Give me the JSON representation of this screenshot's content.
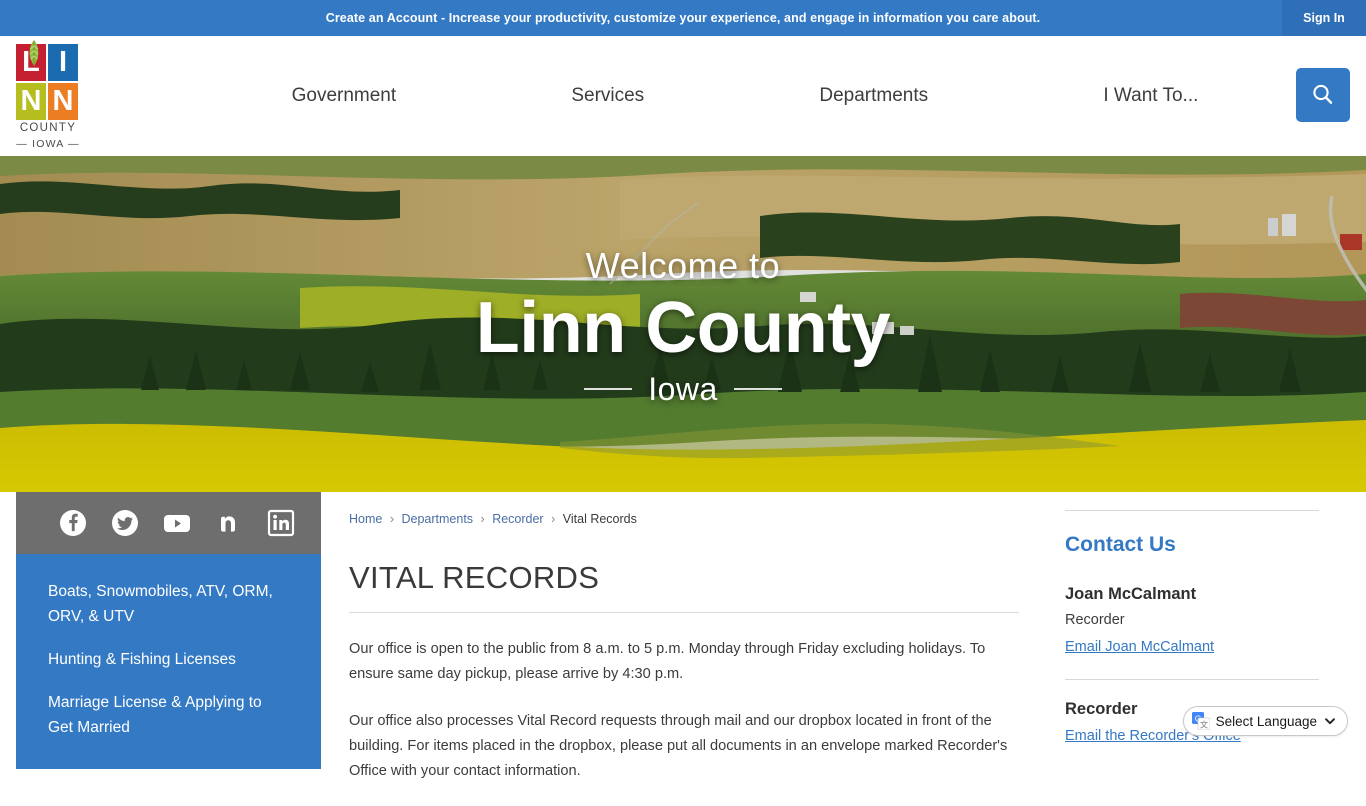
{
  "alert_bar": {
    "message": "Create an Account - Increase your productivity, customize your experience, and engage in information you care about.",
    "sign_in_label": "Sign In",
    "background_color": "#3479c4"
  },
  "header": {
    "logo": {
      "letters": [
        "L",
        "I",
        "N",
        "N"
      ],
      "letter_colors": [
        "#c42032",
        "#1b6bb0",
        "#b5bd1f",
        "#ed7d23"
      ],
      "subtitle_line1": "COUNTY",
      "subtitle_line2": "— IOWA —",
      "icon": "wheat-icon"
    },
    "nav": [
      {
        "label": "Government"
      },
      {
        "label": "Services"
      },
      {
        "label": "Departments"
      },
      {
        "label": "I Want To..."
      }
    ],
    "search_icon": "search-icon"
  },
  "hero": {
    "welcome": "Welcome to",
    "title": "Linn County",
    "state": "Iowa",
    "image_description": "Aerial photo of rolling Iowa farmland with green fields, tree lines, farmsteads and a bright yellow canola field in the foreground"
  },
  "sidebar": {
    "social": [
      {
        "name": "facebook-icon",
        "label": "Facebook"
      },
      {
        "name": "twitter-icon",
        "label": "Twitter"
      },
      {
        "name": "youtube-icon",
        "label": "YouTube"
      },
      {
        "name": "nextdoor-icon",
        "label": "Nextdoor"
      },
      {
        "name": "linkedin-icon",
        "label": "LinkedIn"
      }
    ],
    "links": [
      {
        "label": "Boats, Snowmobiles, ATV, ORM, ORV, & UTV"
      },
      {
        "label": "Hunting & Fishing Licenses"
      },
      {
        "label": "Marriage License & Applying to Get Married"
      }
    ],
    "social_bar_color": "#6e6e6e",
    "nav_color": "#3479c4"
  },
  "main": {
    "breadcrumb": [
      {
        "label": "Home",
        "link": true
      },
      {
        "label": "Departments",
        "link": true
      },
      {
        "label": "Recorder",
        "link": true
      },
      {
        "label": "Vital Records",
        "link": false
      }
    ],
    "breadcrumb_separator": "›",
    "page_title": "VITAL RECORDS",
    "paragraphs": [
      "Our office is open to the public from 8 a.m. to 5 p.m. Monday through Friday excluding holidays. To ensure same day pickup, please arrive by 4:30 p.m.",
      "Our office also processes Vital Record requests through mail and our dropbox located in front of the building. For items placed in the dropbox, please put all documents in an envelope marked Recorder's Office with your contact information."
    ]
  },
  "right_rail": {
    "heading": "Contact Us",
    "contacts": [
      {
        "name": "Joan McCalmant",
        "role": "Recorder",
        "email_label": "Email Joan McCalmant"
      },
      {
        "name": "Recorder",
        "role": "",
        "email_label": "Email the Recorder's Office"
      }
    ]
  },
  "language_widget": {
    "label": "Select Language",
    "icon": "google-translate-icon",
    "chevron": "chevron-down-icon"
  }
}
